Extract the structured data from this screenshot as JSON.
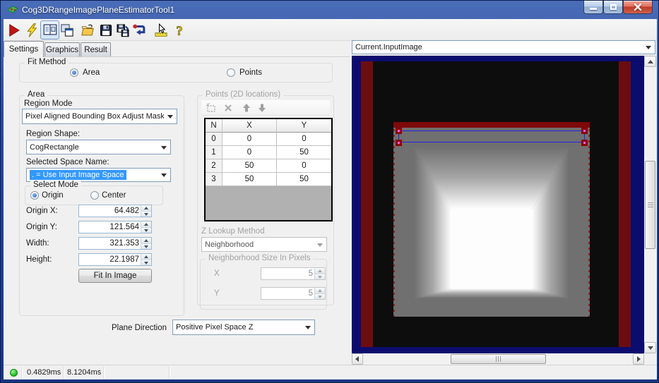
{
  "window": {
    "title": "Cog3DRangeImagePlaneEstimatorTool1"
  },
  "titlebar": {
    "buttons": [
      "minimize",
      "maximize",
      "close"
    ]
  },
  "toolbar": {
    "icons": [
      "run",
      "run-lightning",
      "show-image-display",
      "new-image-display",
      "open-file",
      "save",
      "save-as",
      "reset",
      "pointer-tools",
      "help"
    ]
  },
  "tabs": [
    {
      "label": "Settings",
      "active": true
    },
    {
      "label": "Graphics",
      "active": false
    },
    {
      "label": "Result",
      "active": false
    }
  ],
  "settings": {
    "fit_method": {
      "label": "Fit Method",
      "options": [
        {
          "label": "Area",
          "selected": true
        },
        {
          "label": "Points",
          "selected": false
        }
      ]
    },
    "area": {
      "label": "Area",
      "region_mode_label": "Region Mode",
      "region_mode_value": "Pixel Aligned Bounding Box Adjust Mask",
      "region_shape_label": "Region Shape:",
      "region_shape_value": "CogRectangle",
      "selected_space_label": "Selected Space Name:",
      "selected_space_value": ". = Use Input Image Space",
      "select_mode": {
        "label": "Select Mode",
        "options": [
          {
            "label": "Origin",
            "selected": true
          },
          {
            "label": "Center",
            "selected": false
          }
        ]
      },
      "fields": [
        {
          "label": "Origin X:",
          "value": "64.482"
        },
        {
          "label": "Origin Y:",
          "value": "121.564"
        },
        {
          "label": "Width:",
          "value": "321.353"
        },
        {
          "label": "Height:",
          "value": "22.1987"
        }
      ],
      "fit_button": "Fit In Image"
    },
    "points": {
      "label": "Points (2D locations)",
      "toolbar_icons": [
        "add-point",
        "delete-point",
        "move-up",
        "move-down"
      ],
      "table": {
        "columns": [
          "N",
          "X",
          "Y"
        ],
        "rows": [
          [
            "0",
            "0",
            "0"
          ],
          [
            "1",
            "0",
            "50"
          ],
          [
            "2",
            "50",
            "0"
          ],
          [
            "3",
            "50",
            "50"
          ]
        ]
      },
      "z_lookup_label": "Z Lookup Method",
      "z_lookup_value": "Neighborhood",
      "neighborhood": {
        "label": "Neighborhood Size In Pixels",
        "x_label": "X",
        "x_value": "5",
        "y_label": "Y",
        "y_value": "5"
      }
    },
    "plane_direction": {
      "label": "Plane Direction",
      "value": "Positive Pixel Space Z"
    }
  },
  "image_panel": {
    "source_selector": "Current.InputImage"
  },
  "status_bar": {
    "times": [
      "0.4829ms",
      "8.1204ms"
    ]
  },
  "colors": {
    "selection_highlight": "#3399ff",
    "image_frame_navy": "#0c0c6e",
    "image_mask_red": "#6b0d10",
    "region_outline_blue": "#2222e0",
    "handle_magenta": "#ff5cff",
    "status_led_green": "#28c428"
  }
}
